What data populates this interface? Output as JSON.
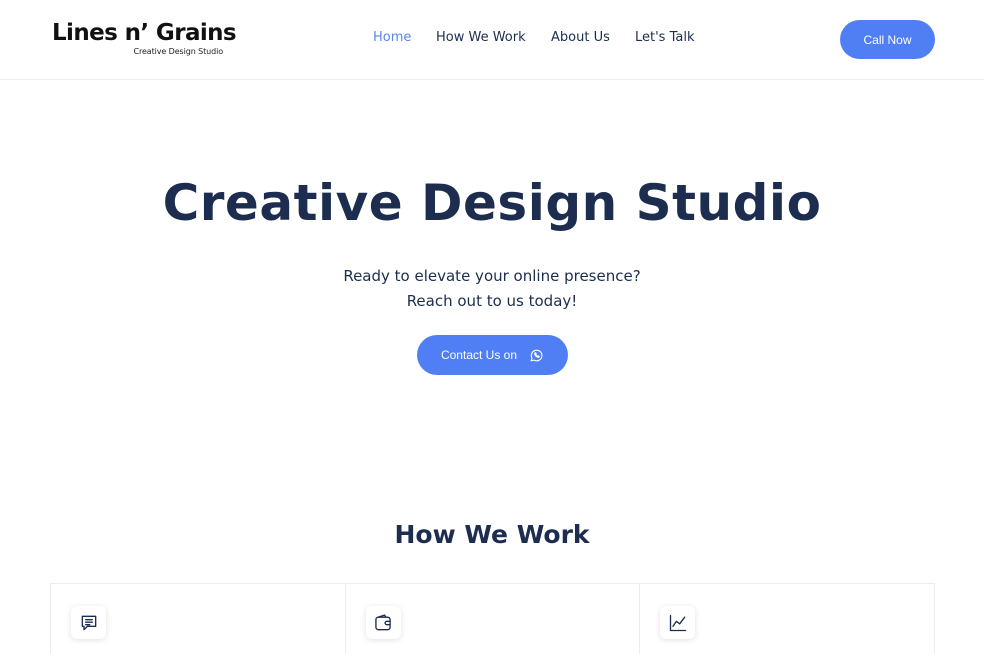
{
  "header": {
    "logo": {
      "main": "Lines n’ Grains",
      "tagline": "Creative Design Studio"
    },
    "nav": [
      {
        "label": "Home",
        "active": true
      },
      {
        "label": "How We Work",
        "active": false
      },
      {
        "label": "About Us",
        "active": false
      },
      {
        "label": "Let's Talk",
        "active": false
      }
    ],
    "call_button": "Call Now"
  },
  "hero": {
    "title": "Creative Design Studio",
    "subtitle_line1": "Ready to elevate your online presence?",
    "subtitle_line2": "Reach out to us today!",
    "contact_button": "Contact Us on",
    "contact_icon": "whatsapp-icon"
  },
  "how_we_work": {
    "title": "How We Work",
    "cards": [
      {
        "icon": "chat-icon"
      },
      {
        "icon": "wallet-icon"
      },
      {
        "icon": "chart-line-icon"
      }
    ]
  },
  "colors": {
    "accent": "#4f7ef5",
    "text": "#1d2d4f",
    "nav_active": "#5b86f0"
  }
}
